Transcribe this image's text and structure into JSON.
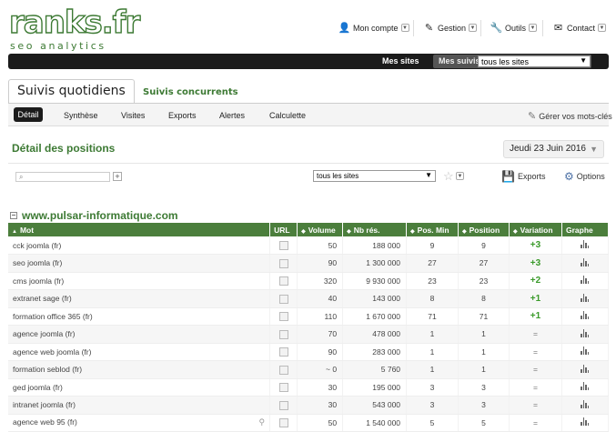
{
  "logo": {
    "main": "ranks.fr",
    "sub": "seo analytics"
  },
  "topnav": [
    {
      "label": "Mon compte",
      "icon": "user-icon"
    },
    {
      "label": "Gestion",
      "icon": "pencil-icon"
    },
    {
      "label": "Outils",
      "icon": "wrench-icon"
    },
    {
      "label": "Contact",
      "icon": "envelope-icon"
    }
  ],
  "bar": {
    "mes_sites": "Mes sites",
    "mes_suivis": "Mes suivis",
    "selected_site": "tous les sites"
  },
  "tabs": {
    "active": "Suivis quotidiens",
    "other": "Suivis concurrents"
  },
  "subnav": [
    "Détail",
    "Synthèse",
    "Visites",
    "Exports",
    "Alertes",
    "Calculette"
  ],
  "gerer": "Gérer vos mots-clés",
  "section": {
    "title": "Détail des positions",
    "date": "Jeudi 23 Juin 2016"
  },
  "filter": {
    "sites": "tous les sites"
  },
  "tools": {
    "exports": "Exports",
    "options": "Options"
  },
  "site": "www.pulsar-informatique.com",
  "table": {
    "headers": [
      "Mot",
      "URL",
      "Volume",
      "Nb rés.",
      "Pos. Min",
      "Position",
      "Variation",
      "Graphe"
    ],
    "rows": [
      {
        "mot": "cck joomla (fr)",
        "volume": "50",
        "nb": "188 000",
        "min": "9",
        "pos": "9",
        "var": "+3"
      },
      {
        "mot": "seo joomla (fr)",
        "volume": "90",
        "nb": "1 300 000",
        "min": "27",
        "pos": "27",
        "var": "+3"
      },
      {
        "mot": "cms joomla (fr)",
        "volume": "320",
        "nb": "9 930 000",
        "min": "23",
        "pos": "23",
        "var": "+2"
      },
      {
        "mot": "extranet sage (fr)",
        "volume": "40",
        "nb": "143 000",
        "min": "8",
        "pos": "8",
        "var": "+1"
      },
      {
        "mot": "formation office 365 (fr)",
        "volume": "110",
        "nb": "1 670 000",
        "min": "71",
        "pos": "71",
        "var": "+1"
      },
      {
        "mot": "agence joomla (fr)",
        "volume": "70",
        "nb": "478 000",
        "min": "1",
        "pos": "1",
        "var": "="
      },
      {
        "mot": "agence web joomla (fr)",
        "volume": "90",
        "nb": "283 000",
        "min": "1",
        "pos": "1",
        "var": "="
      },
      {
        "mot": "formation seblod (fr)",
        "volume": "~ 0",
        "nb": "5 760",
        "min": "1",
        "pos": "1",
        "var": "="
      },
      {
        "mot": "ged joomla (fr)",
        "volume": "30",
        "nb": "195 000",
        "min": "3",
        "pos": "3",
        "var": "="
      },
      {
        "mot": "intranet joomla (fr)",
        "volume": "30",
        "nb": "543 000",
        "min": "3",
        "pos": "3",
        "var": "="
      },
      {
        "mot": "agence web 95 (fr)",
        "volume": "50",
        "nb": "1 540 000",
        "min": "5",
        "pos": "5",
        "var": "="
      }
    ]
  },
  "colors": {
    "brand_green": "#3d7a34",
    "header_green": "#4b7e3c",
    "variation_green": "#3a9a2a",
    "dark_bar": "#1b1b1b"
  }
}
